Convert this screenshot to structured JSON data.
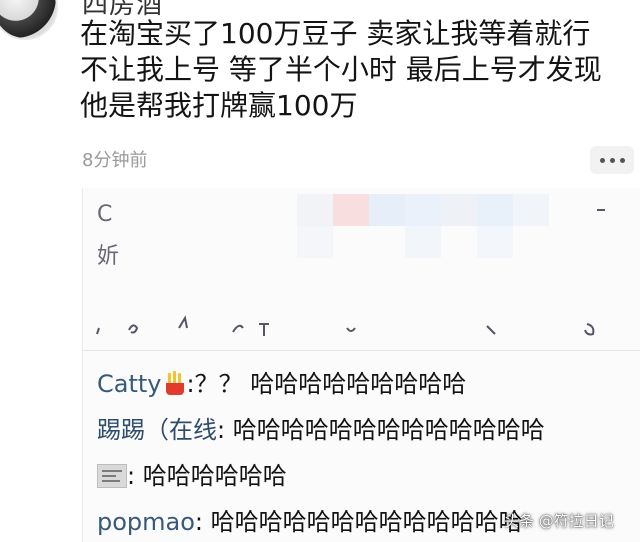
{
  "post": {
    "username": "四房酒",
    "text": "在淘宝买了100万豆子 卖家让我等着就行\n不让我上号 等了半个小时 最后上号才发现\n他是帮我打牌赢100万",
    "time": "8分钟前",
    "more_icon": "more-dots-icon"
  },
  "card": {
    "blurred_glyphs": [
      "C",
      "妡"
    ],
    "chat": [
      {
        "name": "Catty",
        "icon": "fries-icon",
        "message": ":？？ 哈哈哈哈哈哈哈哈哈"
      },
      {
        "name": "踢踢（在线",
        "icon": "",
        "message": ": 哈哈哈哈哈哈哈哈哈哈哈哈哈"
      },
      {
        "name": "",
        "icon": "newspaper-icon",
        "message": ": 哈哈哈哈哈哈"
      },
      {
        "name": "popmao",
        "icon": "",
        "message": ": 哈哈哈哈哈哈哈哈哈哈哈哈哈"
      }
    ]
  },
  "watermark": "头条 @符拉日记",
  "colors": {
    "name_blue": "#385a7a",
    "time_gray": "#9a9a9a",
    "mosaic_red": "#f7d9d9",
    "mosaic_blue": "#dbe8f7"
  }
}
